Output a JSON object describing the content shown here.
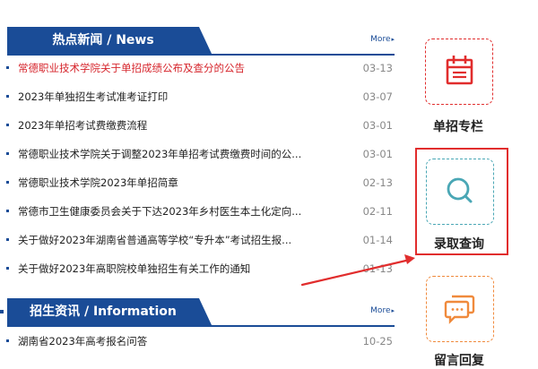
{
  "hot_news": {
    "title": "热点新闻 / News",
    "more_label": "More",
    "items": [
      {
        "title": "常德职业技术学院关于单招成绩公布及查分的公告",
        "date": "03-13",
        "highlight": true
      },
      {
        "title": "2023年单独招生考试准考证打印",
        "date": "03-07"
      },
      {
        "title": "2023年单招考试费缴费流程",
        "date": "03-01"
      },
      {
        "title": "常德职业技术学院关于调整2023年单招考试费缴费时间的公...",
        "date": "03-01"
      },
      {
        "title": "常德职业技术学院2023年单招简章",
        "date": "02-13"
      },
      {
        "title": "常德市卫生健康委员会关于下达2023年乡村医生本土化定向...",
        "date": "02-11"
      },
      {
        "title": "关于做好2023年湖南省普通高等学校“专升本”考试招生报...",
        "date": "01-14"
      },
      {
        "title": "关于做好2023年高职院校单独招生有关工作的通知",
        "date": "01-13"
      }
    ]
  },
  "admissions_info": {
    "title": "招生资讯 / Information",
    "more_label": "More",
    "items": [
      {
        "title": "湖南省2023年高考报名问答",
        "date": "10-25"
      }
    ]
  },
  "quick_links": [
    {
      "label": "单招专栏",
      "icon": "calendar-icon",
      "color": "#e12d2d"
    },
    {
      "label": "录取查询",
      "icon": "search-icon",
      "color": "#4aa7b5"
    },
    {
      "label": "留言回复",
      "icon": "chat-bubbles-icon",
      "color": "#f08a3c"
    }
  ],
  "colors": {
    "brand_blue": "#1a4c97",
    "highlight_red": "#d6252c",
    "annotation_red": "#e12d2d"
  }
}
